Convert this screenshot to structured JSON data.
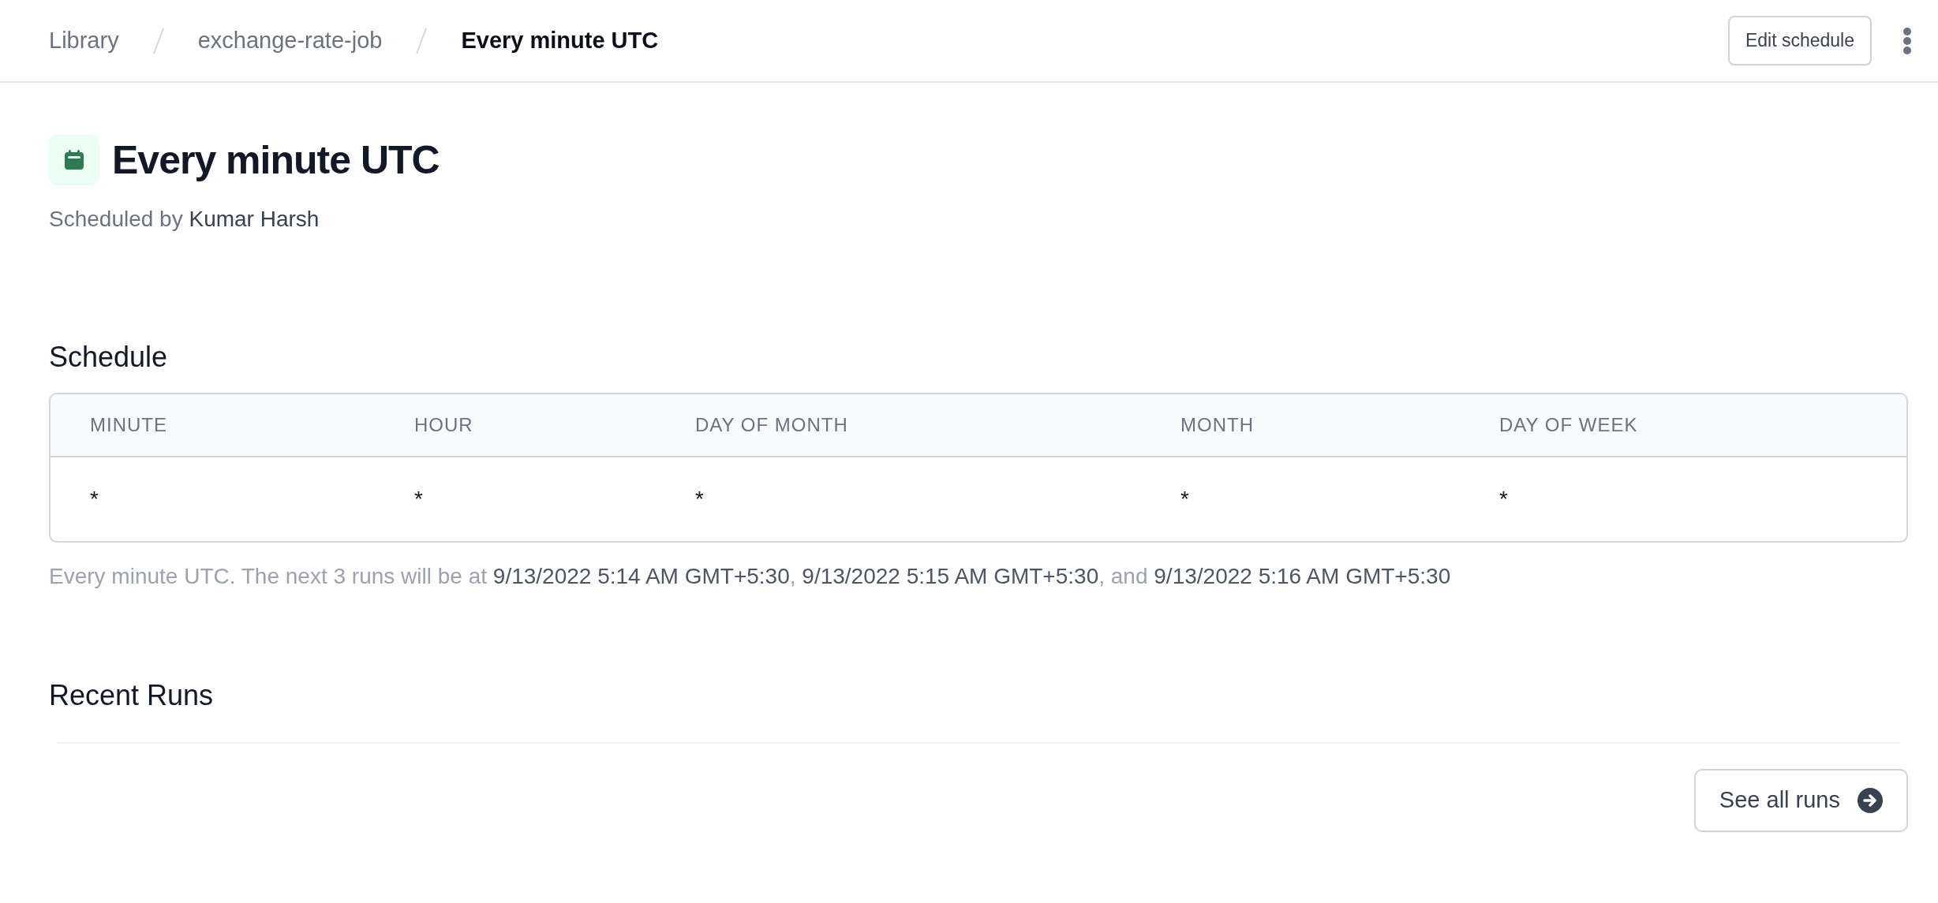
{
  "breadcrumb": [
    {
      "label": "Library",
      "current": false
    },
    {
      "label": "exchange-rate-job",
      "current": false
    },
    {
      "label": "Every minute UTC",
      "current": true
    }
  ],
  "header_actions": {
    "edit_button": "Edit schedule"
  },
  "title": "Every minute UTC",
  "scheduled_by": {
    "label": "Scheduled by",
    "name": "Kumar Harsh"
  },
  "schedule": {
    "heading": "Schedule",
    "columns": [
      "MINUTE",
      "HOUR",
      "DAY OF MONTH",
      "MONTH",
      "DAY OF WEEK"
    ],
    "values": [
      "*",
      "*",
      "*",
      "*",
      "*"
    ],
    "description": "Every minute UTC. The next 3 runs will be at **9/13/2022 5:14 AM GMT+5:30**, **9/13/2022 5:15 AM GMT+5:30**, and **9/13/2022 5:16 AM GMT+5:30**"
  },
  "recent_runs": {
    "heading": "Recent Runs",
    "see_all_button": "See all runs"
  }
}
